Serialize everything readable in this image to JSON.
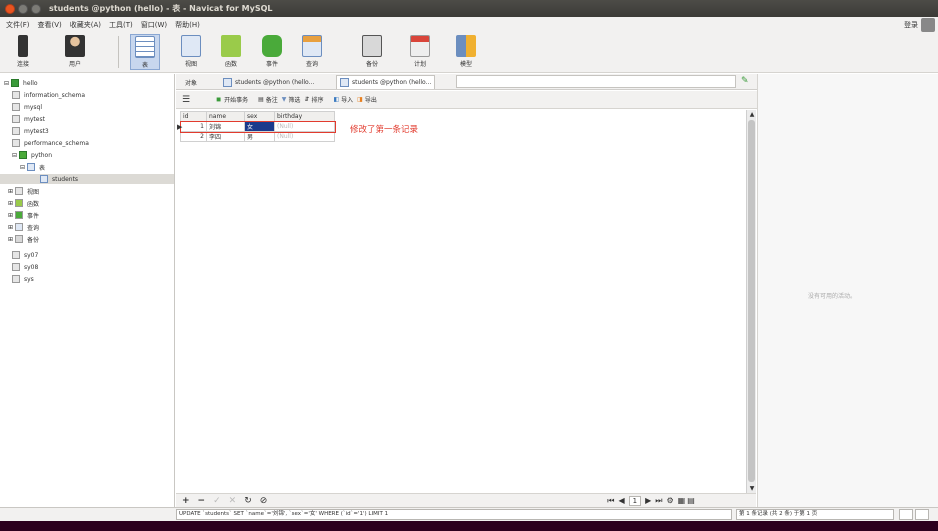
{
  "window": {
    "title": "students @python (hello) - 表 - Navicat for MySQL"
  },
  "menu": [
    "文件(F)",
    "查看(V)",
    "收藏夹(A)",
    "工具(T)",
    "窗口(W)",
    "帮助(H)"
  ],
  "login_label": "登录",
  "toolbar": [
    {
      "label": "连接",
      "icon": "connection-icon"
    },
    {
      "label": "用户",
      "icon": "user-icon"
    },
    {
      "label": "表",
      "icon": "table-icon"
    },
    {
      "label": "视图",
      "icon": "view-icon"
    },
    {
      "label": "函数",
      "icon": "function-icon"
    },
    {
      "label": "事件",
      "icon": "event-icon"
    },
    {
      "label": "查询",
      "icon": "query-icon"
    },
    {
      "label": "备份",
      "icon": "backup-icon"
    },
    {
      "label": "计划",
      "icon": "schedule-icon"
    },
    {
      "label": "模型",
      "icon": "model-icon"
    }
  ],
  "sidebar": {
    "connection": "hello",
    "databases": [
      "information_schema",
      "mysql",
      "mytest",
      "mytest3",
      "performance_schema"
    ],
    "active_db": "python",
    "tables_label": "表",
    "selected_table": "students",
    "sub_nodes": [
      "视图",
      "函数",
      "事件",
      "查询",
      "备份"
    ],
    "other_dbs": [
      "sy07",
      "sy08",
      "sys"
    ]
  },
  "tabs": [
    {
      "label": "对象"
    },
    {
      "label": "students @python (hello..."
    },
    {
      "label": "students @python (hello..."
    }
  ],
  "subtoolbar": [
    "开始事务",
    "备注",
    "筛选",
    "排序",
    "导入",
    "导出"
  ],
  "table": {
    "columns": [
      "id",
      "name",
      "sex",
      "birthday"
    ],
    "rows": [
      [
        "1",
        "刘锦",
        "女",
        "(Null)"
      ],
      [
        "2",
        "李四",
        "男",
        "(Null)"
      ]
    ]
  },
  "annotation": "修改了第一条记录",
  "right_panel": {
    "message": "没有可用的活动。"
  },
  "status": {
    "sql": "UPDATE `students` SET `name`='刘锦', `sex`='女' WHERE (`id`='1') LIMIT 1",
    "record_info": "第 1 条记录 (共 2 条) 于第 1 页"
  },
  "pagination": {
    "current_page": "1"
  }
}
